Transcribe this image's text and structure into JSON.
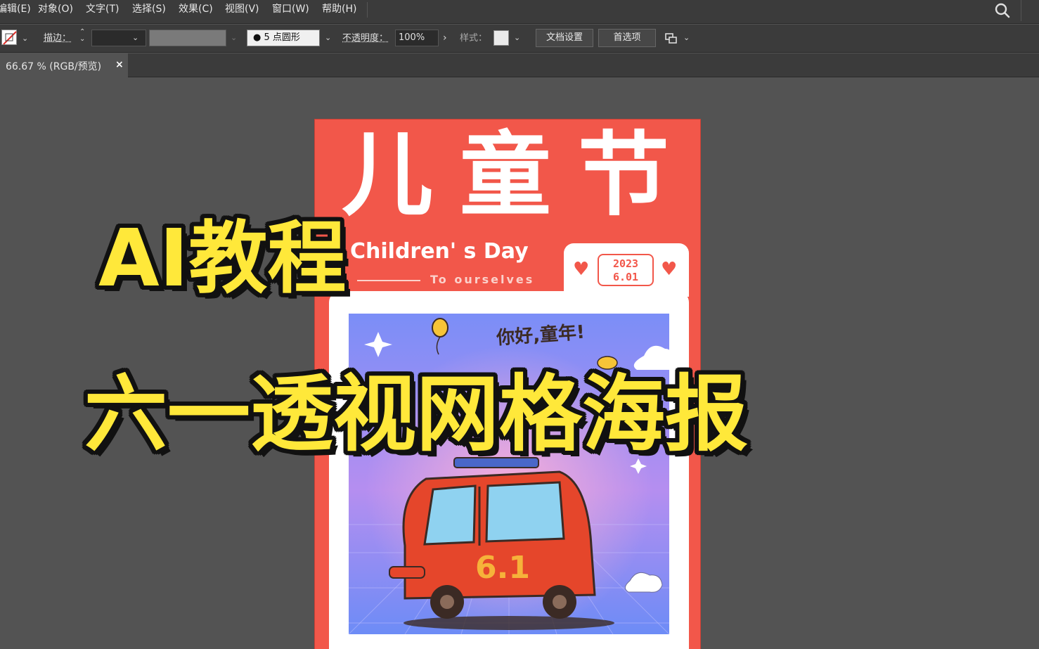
{
  "menu": {
    "items": [
      "编辑(E)",
      "对象(O)",
      "文字(T)",
      "选择(S)",
      "效果(C)",
      "视图(V)",
      "窗口(W)",
      "帮助(H)"
    ]
  },
  "control_bar": {
    "stroke_label": "描边：",
    "brush_label": "5 点圆形",
    "opacity_label": "不透明度：",
    "opacity_value": "100%",
    "style_label": "样式：",
    "doc_setup_button": "文档设置",
    "preferences_button": "首选项"
  },
  "document_tab": {
    "label": "66.67 % (RGB/预览)",
    "close": "×"
  },
  "poster": {
    "title_chars": [
      "儿",
      "童",
      "节"
    ],
    "subtitle": "Children' s Day",
    "tagline": "To ourselves",
    "date_year": "2023",
    "date_day": "6.01",
    "greeting": "你好,童年!",
    "car_number": "6.1",
    "colors": {
      "background": "#f2574a",
      "panel": "#ffffff"
    }
  },
  "overlay": {
    "line1": "AI教程",
    "line2": "六一透视网格海报"
  },
  "icons": [
    "search-icon",
    "fill-swatch-icon",
    "chevron-down-icon",
    "stepper-icon",
    "arrange-icon",
    "heart-icon",
    "close-icon"
  ]
}
